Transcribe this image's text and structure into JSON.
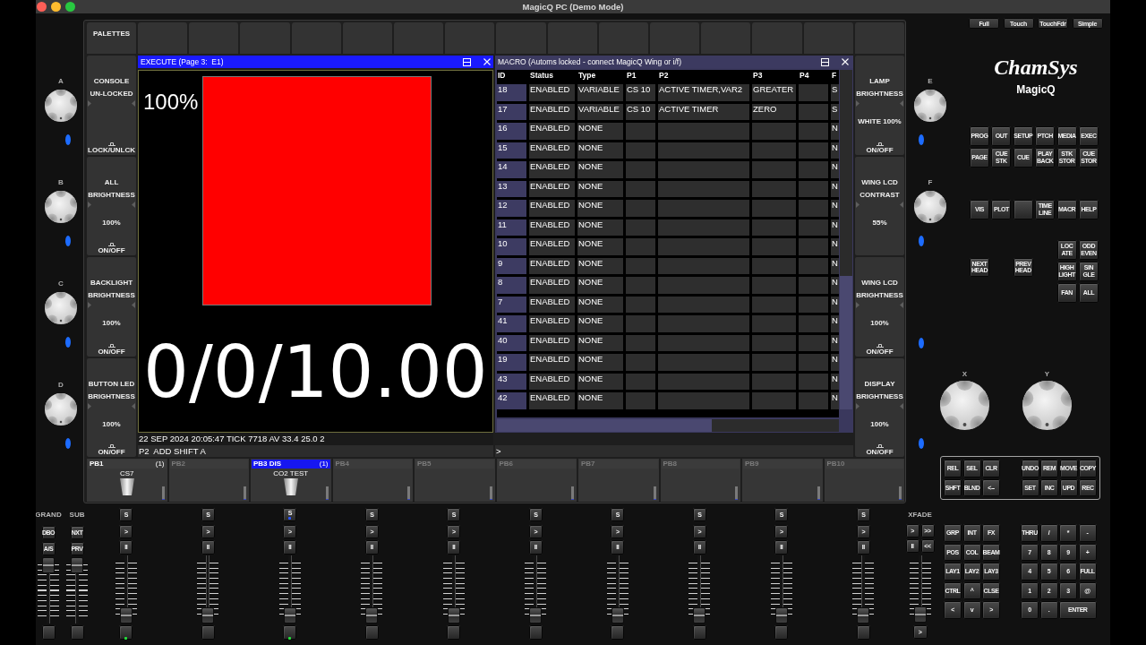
{
  "window": {
    "title": "MagicQ PC (Demo Mode)"
  },
  "left_encoders": [
    {
      "label": "A"
    },
    {
      "label": "B"
    },
    {
      "label": "C"
    },
    {
      "label": "D"
    }
  ],
  "palettes_tab": {
    "label": "PALETTES"
  },
  "left_soft_buttons": [
    {
      "title": "CONSOLE UN-LOCKED",
      "action": "LOCK/UNLCK"
    },
    {
      "title": "ALL BRIGHTNESS",
      "value": "100%",
      "action": "ON/OFF"
    },
    {
      "title": "BACKLIGHT BRIGHTNESS",
      "value": "100%",
      "action": "ON/OFF"
    },
    {
      "title": "BUTTON LED BRIGHTNESS",
      "value": "100%",
      "action": "ON/OFF"
    }
  ],
  "execute_window": {
    "title": "EXECUTE (Page 3:  E1)",
    "items": [
      {
        "intensity": "100%",
        "color": "#ff0000",
        "timing": "0/0/10.00"
      }
    ]
  },
  "macro_window": {
    "title": "MACRO (Automs locked - connect MagicQ Wing or i/f)",
    "columns": [
      "ID",
      "Status",
      "Type",
      "P1",
      "P2",
      "P3",
      "P4",
      "F"
    ],
    "rows": [
      {
        "id": "18",
        "status": "ENABLED",
        "type": "VARIABLE",
        "p1": "CS 10",
        "p2": "ACTIVE TIMER,VAR2",
        "p3": "GREATER",
        "column_8": "S"
      },
      {
        "id": "17",
        "status": "ENABLED",
        "type": "VARIABLE",
        "p1": "CS 10",
        "p2": "ACTIVE TIMER",
        "p3": "ZERO",
        "column_8": "S"
      },
      {
        "id": "16",
        "status": "ENABLED",
        "type": "NONE",
        "column_8": "N"
      },
      {
        "id": "15",
        "status": "ENABLED",
        "type": "NONE",
        "column_8": "N"
      },
      {
        "id": "14",
        "status": "ENABLED",
        "type": "NONE",
        "column_8": "N"
      },
      {
        "id": "13",
        "status": "ENABLED",
        "type": "NONE",
        "column_8": "N"
      },
      {
        "id": "12",
        "status": "ENABLED",
        "type": "NONE",
        "column_8": "N"
      },
      {
        "id": "11",
        "status": "ENABLED",
        "type": "NONE",
        "column_8": "N"
      },
      {
        "id": "10",
        "status": "ENABLED",
        "type": "NONE",
        "column_8": "N"
      },
      {
        "id": "9",
        "status": "ENABLED",
        "type": "NONE",
        "column_8": "N"
      },
      {
        "id": "8",
        "status": "ENABLED",
        "type": "NONE",
        "column_8": "N"
      },
      {
        "id": "7",
        "status": "ENABLED",
        "type": "NONE",
        "column_8": "N"
      },
      {
        "id": "41",
        "status": "ENABLED",
        "type": "NONE",
        "column_8": "N"
      },
      {
        "id": "40",
        "status": "ENABLED",
        "type": "NONE",
        "column_8": "N"
      },
      {
        "id": "19",
        "status": "ENABLED",
        "type": "NONE",
        "column_8": "N"
      },
      {
        "id": "43",
        "status": "ENABLED",
        "type": "NONE",
        "column_8": "N"
      },
      {
        "id": "42",
        "status": "ENABLED",
        "type": "NONE",
        "column_8": "N"
      }
    ]
  },
  "status_line": "22 SEP 2024 20:05:47 TICK 7718 AV 33.4 25.0 2",
  "command_line": "P2  ADD SHIFT A",
  "command_prompt": ">",
  "right_soft_buttons": [
    {
      "title": "LAMP BRIGHTNESS",
      "value": "WHITE 100%",
      "action": "ON/OFF"
    },
    {
      "title": "WING LCD CONTRAST",
      "value": "55%"
    },
    {
      "title": "WING LCD BRIGHTNESS",
      "value": "100%",
      "action": "ON/OFF"
    },
    {
      "title": "DISPLAY BRIGHTNESS",
      "value": "100%",
      "action": "ON/OFF"
    }
  ],
  "playbacks": [
    {
      "label": "PB1",
      "count": "(1)",
      "name": "CS7",
      "selected": false,
      "empty": false
    },
    {
      "label": "PB2",
      "selected": false,
      "empty": true
    },
    {
      "label": "PB3 DIS",
      "count": "(1)",
      "name": "CO2 TEST",
      "selected": true,
      "empty": false
    },
    {
      "label": "PB4",
      "selected": false,
      "empty": true
    },
    {
      "label": "PB5",
      "selected": false,
      "empty": true
    },
    {
      "label": "PB6",
      "selected": false,
      "empty": true
    },
    {
      "label": "PB7",
      "selected": false,
      "empty": true
    },
    {
      "label": "PB8",
      "selected": false,
      "empty": true
    },
    {
      "label": "PB9",
      "selected": false,
      "empty": true
    },
    {
      "label": "PB10",
      "selected": false,
      "empty": true
    }
  ],
  "master_faders": [
    {
      "label": "GRAND",
      "buttons": [
        "DBO",
        "A/S"
      ],
      "level": 1
    },
    {
      "label": "SUB",
      "buttons": [
        "NXT",
        "PRV"
      ],
      "level": 1
    }
  ],
  "playback_faders": [
    {
      "buttons": [
        "S",
        ">",
        "II"
      ],
      "level": 0,
      "s_led": false,
      "flash_led": true
    },
    {
      "buttons": [
        "S",
        ">",
        "II"
      ],
      "level": 0,
      "s_led": false,
      "flash_led": false
    },
    {
      "buttons": [
        "S",
        ">",
        "II"
      ],
      "level": 0,
      "s_led": true,
      "flash_led": true
    },
    {
      "buttons": [
        "S",
        ">",
        "II"
      ],
      "level": 0,
      "s_led": false,
      "flash_led": false
    },
    {
      "buttons": [
        "S",
        ">",
        "II"
      ],
      "level": 0,
      "s_led": false,
      "flash_led": false
    },
    {
      "buttons": [
        "S",
        ">",
        "II"
      ],
      "level": 0,
      "s_led": false,
      "flash_led": false
    },
    {
      "buttons": [
        "S",
        ">",
        "II"
      ],
      "level": 0,
      "s_led": false,
      "flash_led": false
    },
    {
      "buttons": [
        "S",
        ">",
        "II"
      ],
      "level": 0,
      "s_led": false,
      "flash_led": false
    },
    {
      "buttons": [
        "S",
        ">",
        "II"
      ],
      "level": 0,
      "s_led": false,
      "flash_led": false
    },
    {
      "buttons": [
        "S",
        ">",
        "II"
      ],
      "level": 0,
      "s_led": false,
      "flash_led": false
    }
  ],
  "crossfade": {
    "label": "XFADE",
    "buttons": [
      ">",
      ">>",
      "II",
      "<<"
    ],
    "level": 0,
    "go": ">"
  },
  "view_modes": [
    "Full",
    "Touch",
    "TouchFdr",
    "Simple"
  ],
  "logo": {
    "brand": "ChamSys",
    "product": "MagicQ"
  },
  "right_encoders": [
    {
      "label": "E"
    },
    {
      "label": "F"
    }
  ],
  "window_keys": [
    [
      {
        "kind": "key",
        "label": "PROG"
      },
      {
        "kind": "key",
        "label": "OUT"
      },
      {
        "kind": "key",
        "label": "SETUP"
      },
      {
        "kind": "key",
        "label": "PTCH"
      },
      {
        "kind": "key",
        "label": "MEDIA"
      },
      {
        "kind": "key",
        "label": "EXEC"
      }
    ],
    [
      {
        "kind": "key",
        "label": "PAGE"
      },
      {
        "kind": "key",
        "label": "CUE STK"
      },
      {
        "kind": "key",
        "label": "CUE"
      },
      {
        "kind": "key",
        "label": "PLAY BACK"
      },
      {
        "kind": "key",
        "label": "STK STOR"
      },
      {
        "kind": "key",
        "label": "CUE STOR"
      }
    ],
    [
      {
        "kind": "key",
        "label": "VIS"
      },
      {
        "kind": "key",
        "label": "PLOT"
      },
      {
        "kind": "blank"
      },
      {
        "kind": "key",
        "label": "TIME LINE"
      },
      {
        "kind": "key",
        "label": "MACR"
      },
      {
        "kind": "key",
        "label": "HELP"
      }
    ]
  ],
  "head_keys": [
    "NEXT HEAD",
    "PREV HEAD"
  ],
  "selection_keys": [
    "LOC ATE",
    "ODD EVEN",
    "HIGH LIGHT",
    "SIN GLE",
    "FAN",
    "ALL"
  ],
  "xy_encoders": [
    {
      "label": "X"
    },
    {
      "label": "Y"
    }
  ],
  "edit_keys": {
    "left": [
      "REL",
      "SEL",
      "CLR",
      "SHFT",
      "BLND",
      "<--"
    ],
    "right": [
      "UNDO",
      "REM",
      "MOVE",
      "COPY",
      "SET",
      "INC",
      "UPD",
      "REC"
    ]
  },
  "attribute_keys": [
    "GRP",
    "INT",
    "FX",
    "POS",
    "COL",
    "BEAM",
    "LAY1",
    "LAY2",
    "LAY3",
    "CTRL",
    "^",
    "CLSE",
    "<",
    "v",
    ">"
  ],
  "keypad": [
    "THRU",
    "/",
    "*",
    "-",
    "7",
    "8",
    "9",
    "+",
    "4",
    "5",
    "6",
    "FULL",
    "1",
    "2",
    "3",
    "@",
    "0",
    "."
  ],
  "enter_key": "ENTER"
}
